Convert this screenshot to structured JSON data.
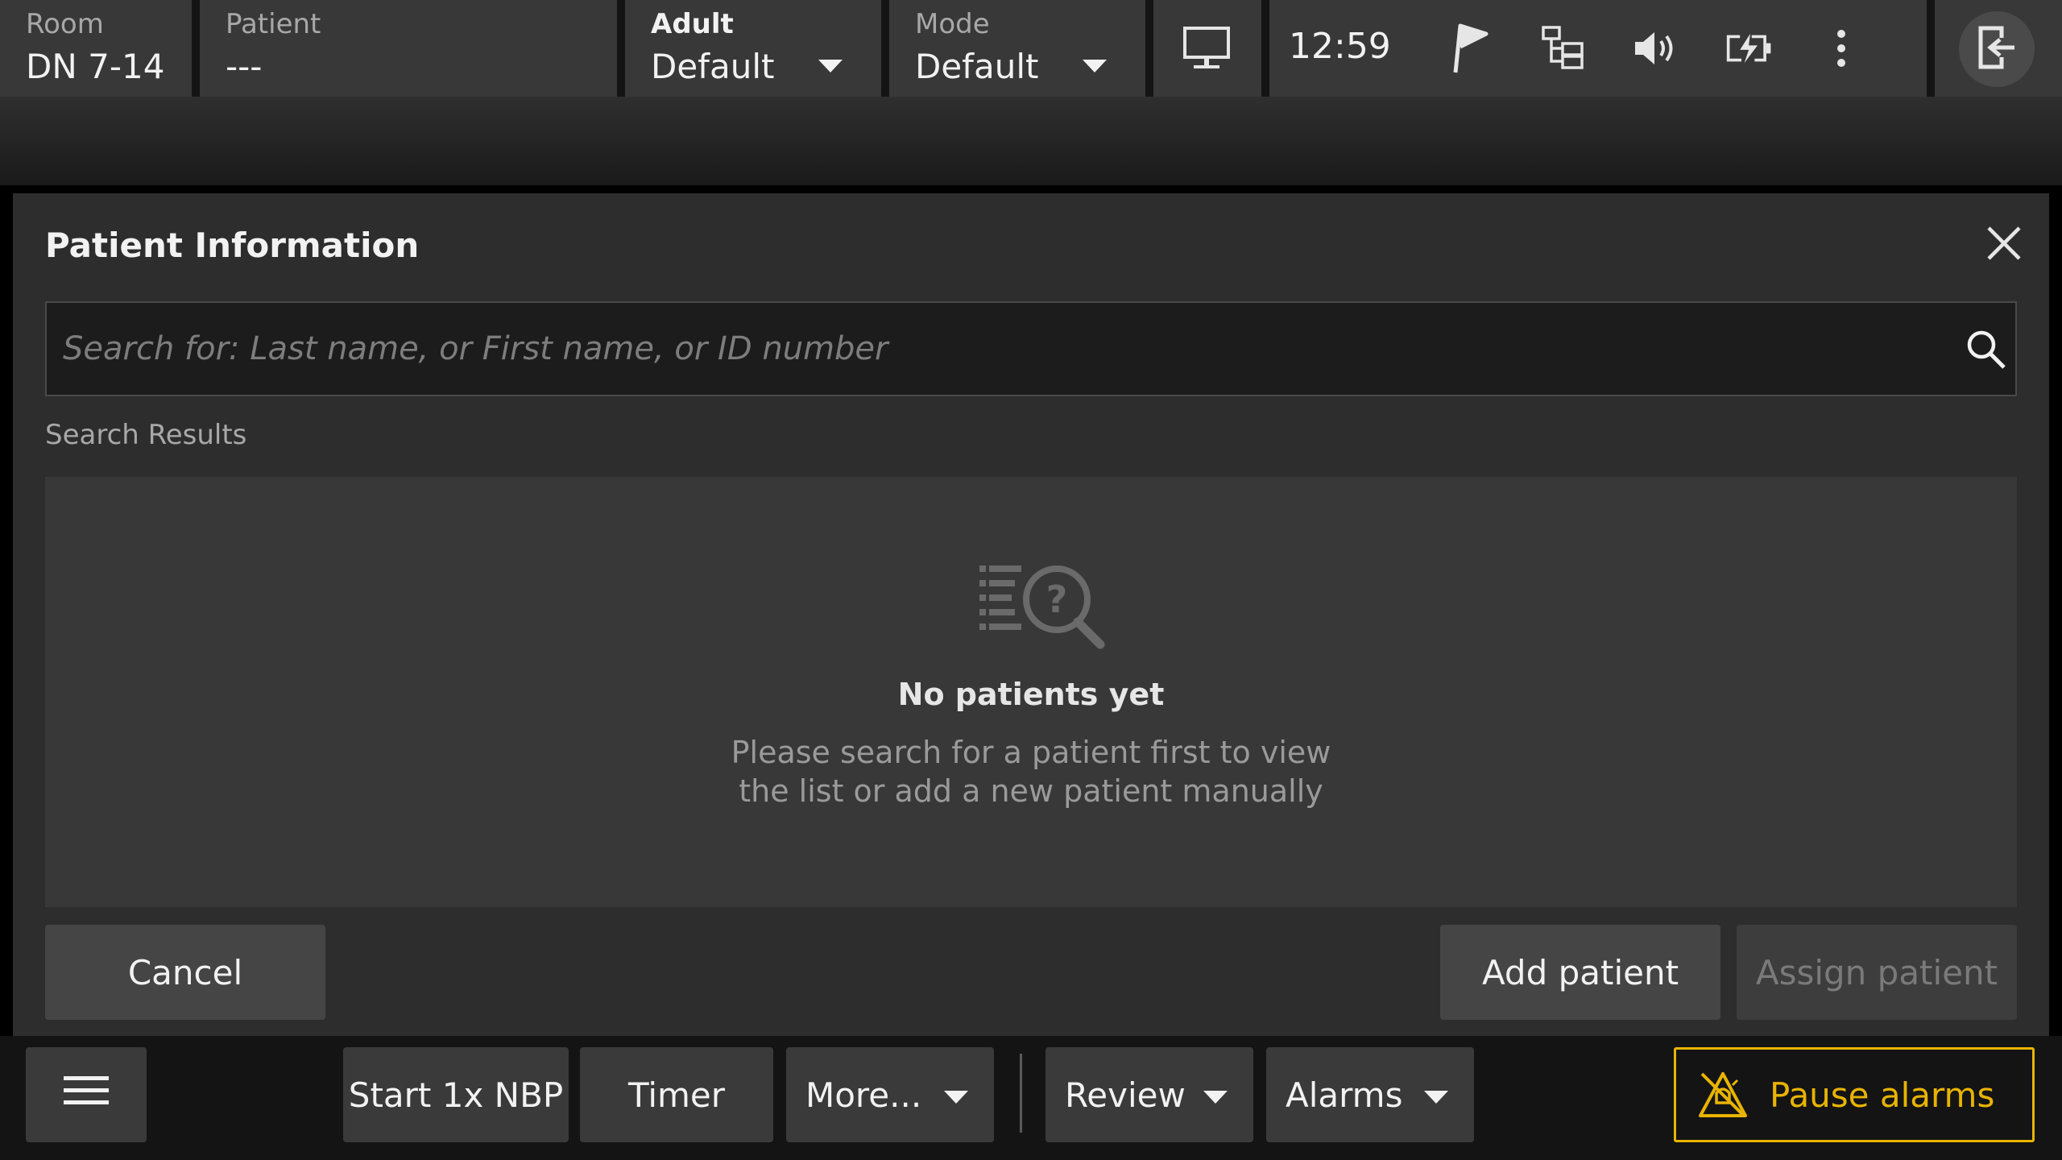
{
  "topbar": {
    "room": {
      "label": "Room",
      "value": "DN 7-14"
    },
    "patient": {
      "label": "Patient",
      "value": "---"
    },
    "category": {
      "label": "Adult",
      "value": "Default"
    },
    "mode": {
      "label": "Mode",
      "value": "Default"
    },
    "time": "12:59",
    "icons": [
      "monitor-icon",
      "flag-icon",
      "network-icon",
      "speaker-icon",
      "battery-charging-icon",
      "more-vertical-icon",
      "exit-icon"
    ]
  },
  "dialog": {
    "title": "Patient Information",
    "search": {
      "placeholder": "Search for: Last name, or First name, or ID number",
      "value": ""
    },
    "results_label": "Search Results",
    "empty": {
      "icon": "search-list-question-icon",
      "title": "No patients yet",
      "line1": "Please search for a patient first to view",
      "line2": "the list or add a new patient manually"
    },
    "buttons": {
      "cancel": "Cancel",
      "add": "Add patient",
      "assign": "Assign patient"
    }
  },
  "bottombar": {
    "menu_icon": "hamburger-menu-icon",
    "start_nbp": "Start 1x NBP",
    "timer": "Timer",
    "more": "More...",
    "review": "Review",
    "alarms": "Alarms",
    "pause_alarms": "Pause alarms",
    "accent_color": "#e8b400"
  }
}
